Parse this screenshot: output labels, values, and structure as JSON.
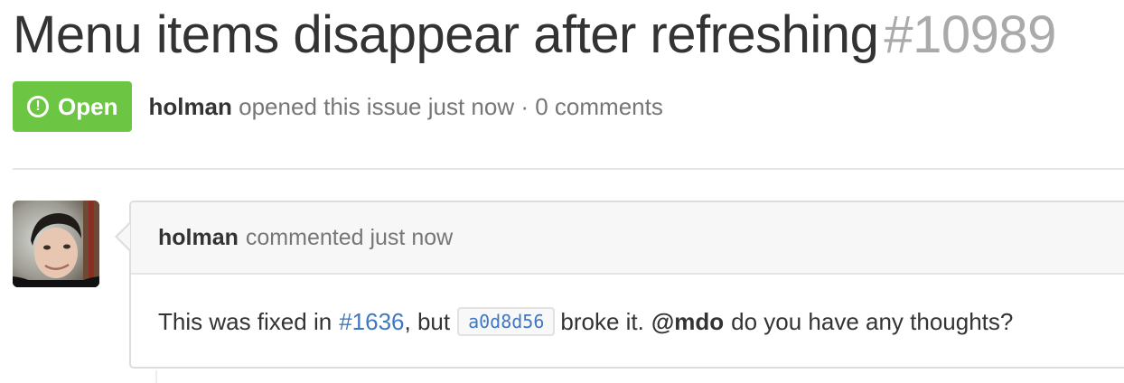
{
  "issue": {
    "title": "Menu items disappear after refreshing",
    "number": "#10989",
    "state_label": "Open",
    "state_icon": "issue-opened-icon",
    "author": "holman",
    "opened_text": "opened this issue just now",
    "separator": "·",
    "comment_count_text": "0 comments"
  },
  "comment": {
    "author": "holman",
    "action_text": "commented just now",
    "body": {
      "text_before": "This was fixed in",
      "issue_link": "#1636",
      "text_mid": ", but",
      "commit_sha": "a0d8d56",
      "text_after": "broke it.",
      "mention": "@mdo",
      "text_end": "do you have any thoughts?"
    }
  },
  "colors": {
    "open_badge": "#6cc644",
    "link": "#4078c0",
    "muted_text": "#767676",
    "issue_number": "#aaaaaa"
  }
}
